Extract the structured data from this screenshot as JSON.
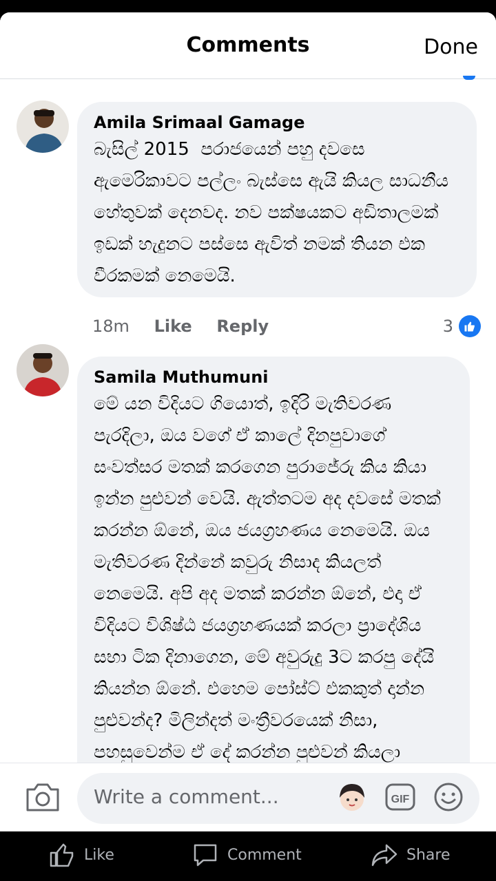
{
  "header": {
    "title": "Comments",
    "done_label": "Done"
  },
  "comments": [
    {
      "author": "Amila Srimaal Gamage",
      "text": "බැසිල් 2015  පරාජයෙන් පහු දවසෙ\nඇමෙරිකාවට පල්ලං බැස්සෙ ඇයි කියල සාධනීය\nහේතුවක් දෙනවද. නව පක්ෂයකට අඩිතාලමක්\nඉඩක් හැදුනට පස්සෙ ඇවිත් නමක් තියන එක\nවීරකමක් නෙමෙයි.",
      "time": "18m",
      "like_label": "Like",
      "reply_label": "Reply",
      "reaction_count": "3"
    },
    {
      "author": "Samila Muthumuni",
      "text": "මේ යන විදියට ගියොත්, ඉදිරි මැතිවරණ\nපැරදිලා, ඔය වගේ ඒ කාලේ දිනපුවාගේ\nසංවත්සර මතක් කරගෙන පුරාජේරු කිය කියා\nඉන්න පුළුවන් වෙයි. ඇත්තටම අද දවසේ මතක්\nකරන්න ඕනේ, ඔය ජයග්‍රහණය නෙමෙයි. ඔය\nමැතිවරණ දින්නේ කවුරු නිසාද කියලත්\nනෙමෙයි. අපි අද මතක් කරන්න ඕනේ, එදා ඒ\nවිදියට විශිෂ්ඨ ජයග්‍රහණයක් කරලා ප්‍රාදේශිය\nසභා ටික දිනාගෙන, මේ අවුරුදු 3ට කරපු දේයි\nකියන්න ඕනේ. එහෙම පෝස්ට් එකකුත් දාන්න\nපුළුවන්ද? මිලින්දත් මංත්‍රීවරයෙක් නිසා,\nපහසුවෙන්ම ඒ දේ කරන්න පුළුවන් කියලා"
    }
  ],
  "composer": {
    "placeholder": "Write a comment..."
  },
  "tabbar": {
    "like_label": "Like",
    "comment_label": "Comment",
    "share_label": "Share"
  },
  "colors": {
    "accent": "#1877f2",
    "bubble": "#f0f2f5",
    "meta": "#65676b"
  }
}
